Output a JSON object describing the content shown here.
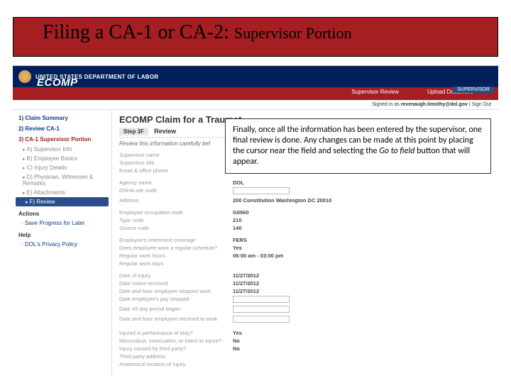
{
  "slide": {
    "title_main": "Filing a CA-1 or CA-2:",
    "title_sub": "Supervisor Portion"
  },
  "app_header": {
    "agency": "UNITED STATES DEPARTMENT OF LABOR",
    "product": "ECOMP",
    "nav1": "Supervisor Review",
    "nav2": "Upload Document",
    "role_badge": "SUPERVISOR",
    "signin_prefix": "Signed in as",
    "signin_user": "revenaugh.timothy@dol.gov",
    "signout": "Sign Out"
  },
  "sidebar": {
    "h1": "1) Claim Summary",
    "h2": "2) Review CA-1",
    "h3": "3) CA-1 Supervisor Portion",
    "steps": {
      "a": "A) Supervisor Info",
      "b": "B) Employee Basics",
      "c": "C) Injury Details",
      "d": "D) Physician, Witnesses & Remarks",
      "e": "E) Attachments",
      "f": "F) Review"
    },
    "actions_h": "Actions",
    "action_save": "Save Progress for Later",
    "help_h": "Help",
    "help_link": "DOL's Privacy Policy"
  },
  "content": {
    "claim_title": "ECOMP Claim for a Traumat",
    "step_tag": "Step 3F",
    "step_name": "Review",
    "instr": "Review this information carefully bef",
    "rows": {
      "sup_name": "Supervisor name",
      "sup_title": "Supervisor title",
      "email_phone": "Email & office phone",
      "agency_name": "Agency name",
      "agency_val": "DOL",
      "osha": "OSHA site code",
      "address": "Address",
      "address_val": "200 Constitution   Washington   DC   20010",
      "occ_code": "Employee occupation code",
      "occ_val": "G0560",
      "type_code": "Type code",
      "type_val": "210",
      "source_code": "Source code",
      "source_val": "140",
      "retire": "Employee's retirement coverage",
      "retire_val": "FERS",
      "reg_sched_q": "Does employee work a regular schedule?",
      "reg_sched_val": "Yes",
      "reg_hours": "Regular work hours",
      "reg_hours_val": "06:00 am   -   03:00 pm",
      "reg_days": "Regular work days",
      "date_injury": "Date of injury",
      "d1": "11/27/2012",
      "date_notice": "Date notice received",
      "d2": "11/27/2012",
      "date_stop": "Date and hour employee stopped work",
      "d3": "11/27/2012",
      "date_paystop": "Date employee's pay stopped",
      "date_45": "Date 45 day period began",
      "date_return": "Date and hour employee returned to work",
      "perf_duty_q": "Injured in performance of duty?",
      "perf_duty_val": "Yes",
      "misconduct_q": "Misconduct, intoxication, or intent to injure?",
      "misconduct_val": "No",
      "third_q": "Injury caused by third party?",
      "third_val": "No",
      "third_addr": "Third party address",
      "anat": "Anatomical location of injury"
    }
  },
  "callout": {
    "text_1": "Finally, once all the information has been entered by the supervisor, one final review is done.  Any changes can be made at this point by placing the cursor near the field and selecting the ",
    "text_2": "Go to field",
    "text_3": " button that will appear."
  }
}
